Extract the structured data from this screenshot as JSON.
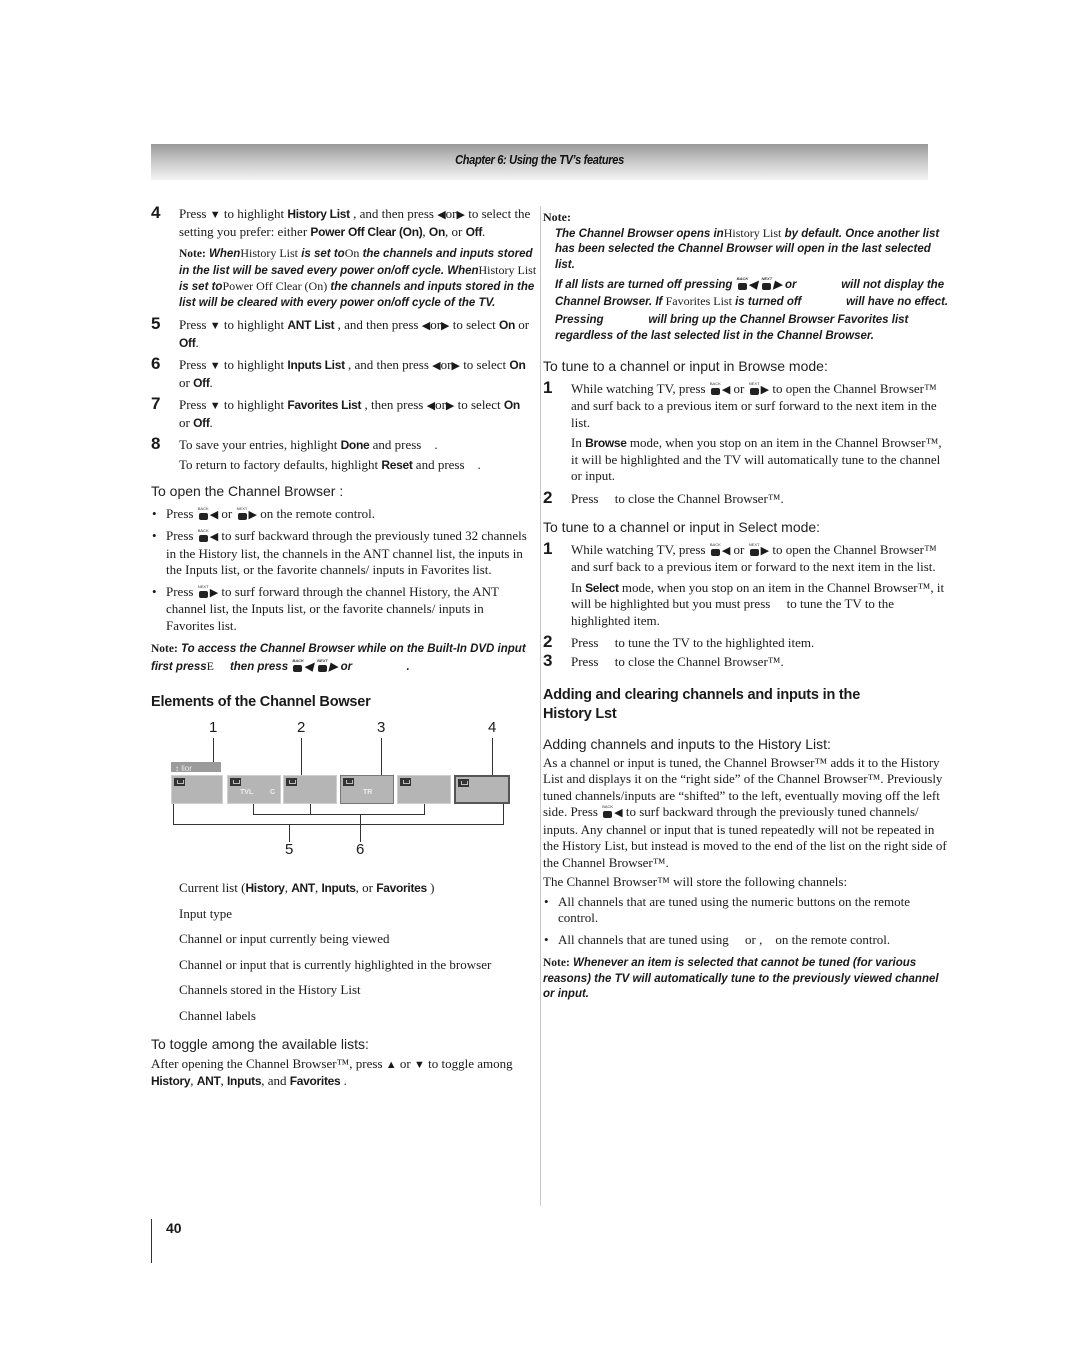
{
  "header": {
    "title": "Chapter 6: Using the TV’s features"
  },
  "left": {
    "step4": {
      "num": "4",
      "t1": "Press",
      "t2": "to highlight",
      "b1": "History List",
      "t3": ", and then press",
      "t4": "or",
      "t5": "to select the setting you prefer: either",
      "b2": "Power Off Clear (On)",
      "t6": ",",
      "b3": "On",
      "t7": ", or",
      "b4": "Off",
      "t8": "."
    },
    "note1": {
      "label": "Note:",
      "i1": "When",
      "r1": "History List",
      "i2": "is set to",
      "r2": "On",
      "i3": "the channels and inputs stored in the list will be saved every power on/off cycle. When",
      "r3": "History List",
      "i4": "is set to",
      "r4": "Power Off Clear (On)",
      "i5": "the channels and inputs stored in the list will be cleared with every power on/off cycle of the TV."
    },
    "step5": {
      "num": "5",
      "t1": "Press",
      "t2": "to highlight",
      "b1": "ANT List",
      "t3": ", and then press",
      "t4": "or",
      "t5": "to select",
      "b2": "On",
      "t6": "or",
      "b3": "Off",
      "t7": "."
    },
    "step6": {
      "num": "6",
      "t1": "Press",
      "t2": "to highlight",
      "b1": "Inputs List",
      "t3": ", and then press",
      "t4": "or",
      "t5": "to select",
      "b2": "On",
      "t6": "or",
      "b3": "Off",
      "t7": "."
    },
    "step7": {
      "num": "7",
      "t1": "Press",
      "t2": "to highlight",
      "b1": "Favorites List",
      "t3": ", then press",
      "t4": "or",
      "t5": "to select",
      "b2": "On",
      "t6": "or",
      "b3": "Off",
      "t7": "."
    },
    "step8": {
      "num": "8",
      "t1": "To save your entries, highlight",
      "b1": "Done",
      "t2": "and press",
      "t3": ".",
      "t4": "To return to factory defaults, highlight",
      "b2": "Reset",
      "t5": "and press",
      "t6": "."
    },
    "open_heading": "To open the Channel Browser :",
    "open_bullets": {
      "b1_a": "Press",
      "b1_b": "or",
      "b1_c": "on the remote control.",
      "b2_a": "Press",
      "b2_b": "to surf backward through the previously tuned 32 channels in the History list, the channels in the ANT channel list, the inputs in the Inputs list, or the favorite channels/ inputs in Favorites list.",
      "b3_a": "Press",
      "b3_b": "to surf forward through the channel History, the ANT channel list, the Inputs list, or the favorite channels/ inputs in Favorites list."
    },
    "note2": {
      "label": "Note:",
      "i1": "To access the Channel Browser while on the Built-In DVD input first press",
      "r1": "E",
      "i2": "then press",
      "i3": "or",
      "i4": "."
    },
    "elements_heading": "Elements of the Channel Bowser",
    "diagram": {
      "numbers": [
        "1",
        "2",
        "3",
        "4",
        "5",
        "6"
      ],
      "list_label": "↕ lior",
      "tile_labels": {
        "tvl": "TVL",
        "c": "C",
        "tr": "TR"
      }
    },
    "legend": {
      "l1_a": "Current list (",
      "l1_b1": "History",
      "l1_c": ",",
      "l1_b2": "ANT",
      "l1_d": ",",
      "l1_b3": "Inputs",
      "l1_e": ", or",
      "l1_b4": "Favorites",
      "l1_f": ")",
      "l2": "Input type",
      "l3": "Channel or input currently being viewed",
      "l4": "Channel or input that is currently highlighted in the browser",
      "l5": "Channels stored in the History List",
      "l6": "Channel labels"
    },
    "toggle_heading": "To toggle among the available lists:",
    "toggle": {
      "t1": "After opening the Channel Browser™, press",
      "t2": "or",
      "t3": "to toggle among",
      "b1": "History",
      "t4": ",",
      "b2": "ANT",
      "t5": ",",
      "b3": "Inputs",
      "t6": ", and",
      "b4": "Favorites",
      "t7": "."
    }
  },
  "right": {
    "note": {
      "label": "Note:",
      "p1_a": "The Channel Browser opens in",
      "p1_r": "History List",
      "p1_b": "by default. Once another list has been selected the Channel Browser will open in the last selected list.",
      "p2_a": "If all lists are turned off pressing",
      "p2_b": "or",
      "p2_c": "will not display the Channel Browser.",
      "p2_d": "If",
      "p2_r": "Favorites List",
      "p2_e": "is turned off",
      "p2_f": "will have no effect.",
      "p3_a": "Pressing",
      "p3_b": "will bring up the Channel Browser Favorites list regardless of the last selected list in the Channel Browser."
    },
    "browse_heading": "To tune to a channel or input in Browse mode:",
    "browse1": {
      "num": "1",
      "t1": "While watching TV, press",
      "t2": "or",
      "t3": "to open the Channel Browser™ and surf back to a previous item or surf forward to the next item in the list.",
      "t4": "In",
      "b1": "Browse",
      "t5": "mode, when you stop on an item in the Channel Browser™, it will be highlighted and the TV will automatically tune to the channel or input."
    },
    "browse2": {
      "num": "2",
      "t1": "Press",
      "t2": "to close the Channel Browser™."
    },
    "select_heading": "To tune to a channel or input in Select mode:",
    "select1": {
      "num": "1",
      "t1": "While watching TV, press",
      "t2": "or",
      "t3": "to open the Channel Browser™ and surf back to a previous item or forward to the next item in the list.",
      "t4": "In",
      "b1": "Select",
      "t5": "mode, when you stop on an item in the Channel Browser™, it will be highlighted but you must press",
      "t6": "to tune the TV to the highlighted item."
    },
    "select2": {
      "num": "2",
      "t1": "Press",
      "t2": "to tune the TV to the highlighted item."
    },
    "select3": {
      "num": "3",
      "t1": "Press",
      "t2": "to close the Channel Browser™."
    },
    "adding_heading": "Adding and clearing channels and inputs in the History Lst",
    "adding_sub": "Adding channels and inputs to the History List:",
    "adding_p1_a": "As a channel or input is tuned, the Channel Browser™ adds it to the History List and displays it on the “right side” of the Channel Browser™. Previously tuned channels/inputs are “shifted” to the left, eventually moving off the left side. Press",
    "adding_p1_b": "to surf backward through the previously tuned channels/ inputs. Any channel or input that is tuned repeatedly will not be repeated in the History List, but instead is moved to the end of the list on the right side of the Channel Browser™.",
    "adding_p2": "The Channel Browser™ will store the following channels:",
    "adding_b1": "All channels that are tuned using the numeric buttons on the remote control.",
    "adding_b2_a": "All channels that are tuned using",
    "adding_b2_b": "or ,",
    "adding_b2_c": "on the remote control.",
    "note_end": {
      "label": "Note:",
      "text": "Whenever an item is selected that cannot be tuned (for various reasons) the TV will automatically tune to the previously viewed channel or input."
    }
  },
  "remote_buttons": {
    "back": "BACK",
    "next": "NEXT"
  },
  "icons": {
    "down": "▼",
    "up": "▲",
    "left": "◀",
    "right": "▶"
  },
  "footer": {
    "page_number": "40"
  }
}
